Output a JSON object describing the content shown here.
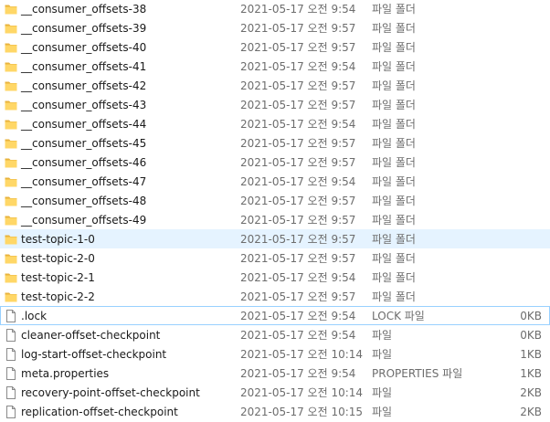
{
  "file_list": {
    "items": [
      {
        "name": "__consumer_offsets-38",
        "date": "2021-05-17 오전 9:54",
        "type": "파일 폴더",
        "size": "",
        "icon": "folder-icon"
      },
      {
        "name": "__consumer_offsets-39",
        "date": "2021-05-17 오전 9:57",
        "type": "파일 폴더",
        "size": "",
        "icon": "folder-icon"
      },
      {
        "name": "__consumer_offsets-40",
        "date": "2021-05-17 오전 9:57",
        "type": "파일 폴더",
        "size": "",
        "icon": "folder-icon"
      },
      {
        "name": "__consumer_offsets-41",
        "date": "2021-05-17 오전 9:54",
        "type": "파일 폴더",
        "size": "",
        "icon": "folder-icon"
      },
      {
        "name": "__consumer_offsets-42",
        "date": "2021-05-17 오전 9:57",
        "type": "파일 폴더",
        "size": "",
        "icon": "folder-icon"
      },
      {
        "name": "__consumer_offsets-43",
        "date": "2021-05-17 오전 9:57",
        "type": "파일 폴더",
        "size": "",
        "icon": "folder-icon"
      },
      {
        "name": "__consumer_offsets-44",
        "date": "2021-05-17 오전 9:54",
        "type": "파일 폴더",
        "size": "",
        "icon": "folder-icon"
      },
      {
        "name": "__consumer_offsets-45",
        "date": "2021-05-17 오전 9:57",
        "type": "파일 폴더",
        "size": "",
        "icon": "folder-icon"
      },
      {
        "name": "__consumer_offsets-46",
        "date": "2021-05-17 오전 9:57",
        "type": "파일 폴더",
        "size": "",
        "icon": "folder-icon"
      },
      {
        "name": "__consumer_offsets-47",
        "date": "2021-05-17 오전 9:54",
        "type": "파일 폴더",
        "size": "",
        "icon": "folder-icon"
      },
      {
        "name": "__consumer_offsets-48",
        "date": "2021-05-17 오전 9:57",
        "type": "파일 폴더",
        "size": "",
        "icon": "folder-icon"
      },
      {
        "name": "__consumer_offsets-49",
        "date": "2021-05-17 오전 9:57",
        "type": "파일 폴더",
        "size": "",
        "icon": "folder-icon"
      },
      {
        "name": "test-topic-1-0",
        "date": "2021-05-17 오전 9:57",
        "type": "파일 폴더",
        "size": "",
        "icon": "folder-icon",
        "state": "hover"
      },
      {
        "name": "test-topic-2-0",
        "date": "2021-05-17 오전 9:57",
        "type": "파일 폴더",
        "size": "",
        "icon": "folder-icon"
      },
      {
        "name": "test-topic-2-1",
        "date": "2021-05-17 오전 9:54",
        "type": "파일 폴더",
        "size": "",
        "icon": "folder-icon"
      },
      {
        "name": "test-topic-2-2",
        "date": "2021-05-17 오전 9:57",
        "type": "파일 폴더",
        "size": "",
        "icon": "folder-icon"
      },
      {
        "name": ".lock",
        "date": "2021-05-17 오전 9:54",
        "type": "LOCK 파일",
        "size": "0KB",
        "icon": "file-icon",
        "state": "focus"
      },
      {
        "name": "cleaner-offset-checkpoint",
        "date": "2021-05-17 오전 9:54",
        "type": "파일",
        "size": "0KB",
        "icon": "file-icon"
      },
      {
        "name": "log-start-offset-checkpoint",
        "date": "2021-05-17 오전 10:14",
        "type": "파일",
        "size": "1KB",
        "icon": "file-icon"
      },
      {
        "name": "meta.properties",
        "date": "2021-05-17 오전 9:54",
        "type": "PROPERTIES 파일",
        "size": "1KB",
        "icon": "file-icon"
      },
      {
        "name": "recovery-point-offset-checkpoint",
        "date": "2021-05-17 오전 10:14",
        "type": "파일",
        "size": "2KB",
        "icon": "file-icon"
      },
      {
        "name": "replication-offset-checkpoint",
        "date": "2021-05-17 오전 10:15",
        "type": "파일",
        "size": "2KB",
        "icon": "file-icon"
      }
    ]
  },
  "colors": {
    "folder": "#ffd767",
    "folder_dark": "#e8b33d",
    "hover_bg": "#e5f3ff",
    "focus_border": "#99d1ff",
    "secondary_text": "#6d6d6d"
  }
}
